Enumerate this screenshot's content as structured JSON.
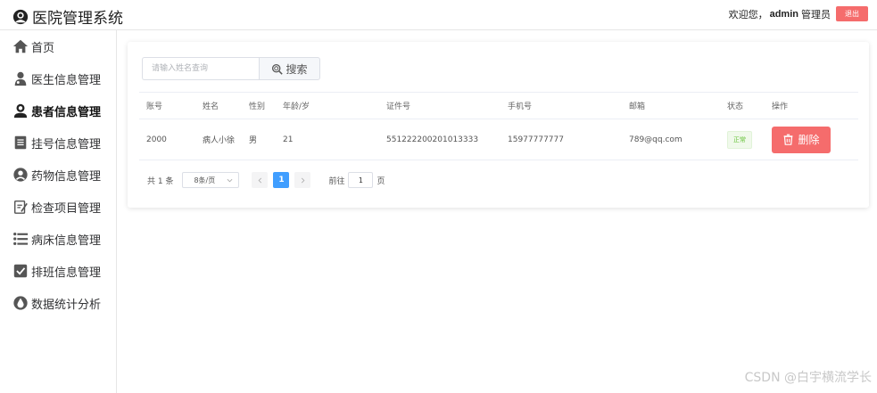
{
  "header": {
    "title": "医院管理系统",
    "welcome": "欢迎您，",
    "username": "admin",
    "role": "管理员",
    "logout_label": "退出"
  },
  "sidebar": {
    "items": [
      {
        "label": "首页",
        "icon": "home-icon"
      },
      {
        "label": "医生信息管理",
        "icon": "doctor-icon"
      },
      {
        "label": "患者信息管理",
        "icon": "patient-icon",
        "active": true
      },
      {
        "label": "挂号信息管理",
        "icon": "register-icon"
      },
      {
        "label": "药物信息管理",
        "icon": "medicine-icon"
      },
      {
        "label": "检查项目管理",
        "icon": "checklist-icon"
      },
      {
        "label": "病床信息管理",
        "icon": "bed-list-icon"
      },
      {
        "label": "排班信息管理",
        "icon": "schedule-check-icon"
      },
      {
        "label": "数据统计分析",
        "icon": "stats-drop-icon"
      }
    ]
  },
  "search": {
    "placeholder": "请输入姓名查询",
    "button_label": "搜索"
  },
  "table": {
    "columns": [
      "账号",
      "姓名",
      "性别",
      "年龄/岁",
      "证件号",
      "手机号",
      "邮箱",
      "状态",
      "操作"
    ],
    "rows": [
      {
        "account": "2000",
        "name": "病人小徐",
        "gender": "男",
        "age": "21",
        "id_number": "551222200201013333",
        "phone": "15977777777",
        "email": "789@qq.com",
        "status": "正常",
        "action": "删除"
      }
    ]
  },
  "pagination": {
    "total": "共 1 条",
    "page_size": "8条/页",
    "current_page": "1",
    "goto_label": "前往",
    "goto_value": "1",
    "page_unit": "页"
  },
  "watermark": "CSDN @白宇横流学长",
  "colors": {
    "danger": "#f56c6c",
    "primary": "#409eff",
    "success": "#67c23a"
  }
}
